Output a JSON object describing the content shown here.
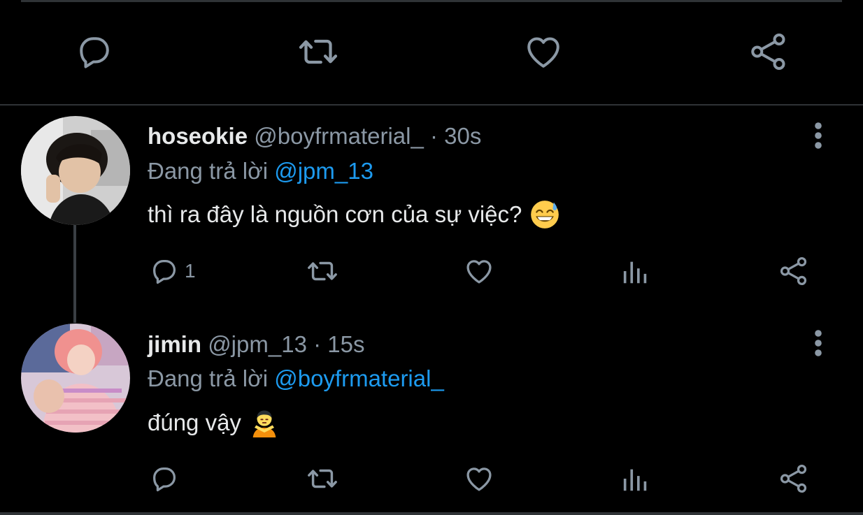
{
  "colors": {
    "background": "#000000",
    "icon": "#8b98a5",
    "mention": "#1d9bf0",
    "text": "#e7e9ea",
    "divider": "#2f3336"
  },
  "main_actions": {
    "reply_icon": "speech-bubble-icon",
    "retweet_icon": "retweet-icon",
    "like_icon": "heart-icon",
    "share_icon": "share-icon"
  },
  "tweets": [
    {
      "name": "hoseokie",
      "handle": "@boyfrmaterial_",
      "separator": "·",
      "time": "30s",
      "reply_prefix": "Đang trả lời",
      "reply_mention": "@jpm_13",
      "text": "thì ra đây là nguồn cơn của sự việc?",
      "emoji": "😅",
      "reply_count": "1"
    },
    {
      "name": "jimin",
      "handle": "@jpm_13",
      "separator": "·",
      "time": "15s",
      "reply_prefix": "Đang trả lời",
      "reply_mention": "@boyfrmaterial_",
      "text": "đúng vậy",
      "emoji": "🙅",
      "reply_count": ""
    }
  ]
}
